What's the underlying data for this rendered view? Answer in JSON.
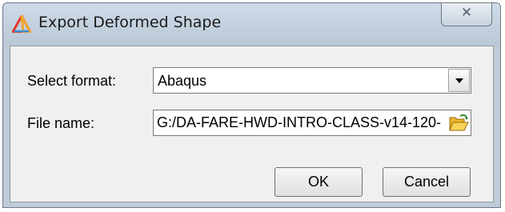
{
  "window": {
    "title": "Export Deformed Shape",
    "icon": "app-triangle-icon",
    "close_label": "✕"
  },
  "form": {
    "format_label": "Select format:",
    "format_value": "Abaqus",
    "filename_label": "File name:",
    "filename_value": "G:/DA-FARE-HWD-INTRO-CLASS-v14-120-"
  },
  "buttons": {
    "ok_label": "OK",
    "cancel_label": "Cancel"
  },
  "colors": {
    "titlebar": "#c3d0dd",
    "client_bg": "#f0f0f0",
    "folder_icon": "#f0c23a"
  }
}
